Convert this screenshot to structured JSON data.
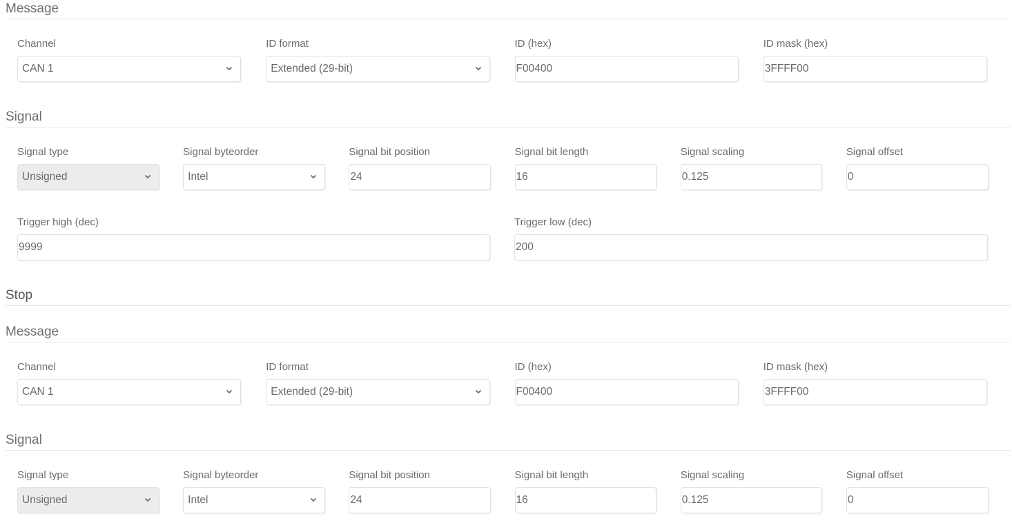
{
  "start": {
    "message": {
      "heading": "Message",
      "channel": {
        "label": "Channel",
        "value": "CAN 1"
      },
      "id_format": {
        "label": "ID format",
        "value": "Extended (29-bit)"
      },
      "id": {
        "label": "ID (hex)",
        "value": "F00400"
      },
      "id_mask": {
        "label": "ID mask (hex)",
        "value": "3FFFF00"
      }
    },
    "signal": {
      "heading": "Signal",
      "type": {
        "label": "Signal type",
        "value": "Unsigned"
      },
      "byteorder": {
        "label": "Signal byteorder",
        "value": "Intel"
      },
      "bit_position": {
        "label": "Signal bit position",
        "value": "24"
      },
      "bit_length": {
        "label": "Signal bit length",
        "value": "16"
      },
      "scaling": {
        "label": "Signal scaling",
        "value": "0.125"
      },
      "offset": {
        "label": "Signal offset",
        "value": "0"
      }
    },
    "trigger_high": {
      "label": "Trigger high (dec)",
      "value": "9999"
    },
    "trigger_low": {
      "label": "Trigger low (dec)",
      "value": "200"
    }
  },
  "stop": {
    "heading": "Stop",
    "message": {
      "heading": "Message",
      "channel": {
        "label": "Channel",
        "value": "CAN 1"
      },
      "id_format": {
        "label": "ID format",
        "value": "Extended (29-bit)"
      },
      "id": {
        "label": "ID (hex)",
        "value": "F00400"
      },
      "id_mask": {
        "label": "ID mask (hex)",
        "value": "3FFFF00"
      }
    },
    "signal": {
      "heading": "Signal",
      "type": {
        "label": "Signal type",
        "value": "Unsigned"
      },
      "byteorder": {
        "label": "Signal byteorder",
        "value": "Intel"
      },
      "bit_position": {
        "label": "Signal bit position",
        "value": "24"
      },
      "bit_length": {
        "label": "Signal bit length",
        "value": "16"
      },
      "scaling": {
        "label": "Signal scaling",
        "value": "0.125"
      },
      "offset": {
        "label": "Signal offset",
        "value": "0"
      }
    }
  },
  "icons": {
    "select_arrow": "chevron-down-icon"
  }
}
